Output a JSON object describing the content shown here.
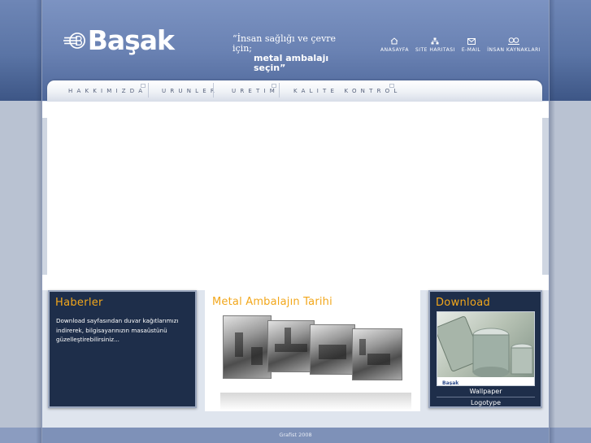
{
  "brand": {
    "name": "Başak"
  },
  "slogan": {
    "line1": "“İnsan sağlığı ve çevre için;",
    "line2": "metal ambalajı seçin”"
  },
  "toplinks": [
    {
      "label": "ANASAYFA",
      "icon": "home-icon"
    },
    {
      "label": "SITE HARITASI",
      "icon": "sitemap-icon"
    },
    {
      "label": "E-MAIL",
      "icon": "mail-icon"
    },
    {
      "label": "İNSAN KAYNAKLARI",
      "icon": "people-icon"
    }
  ],
  "nav": [
    {
      "label": "HAKKIMIZDA"
    },
    {
      "label": "URUNLER"
    },
    {
      "label": "URETIM"
    },
    {
      "label": "KALITE KONTROL"
    }
  ],
  "news": {
    "title": "Haberler",
    "text": "Download sayfasından duvar kağıtlarımızı indirerek, bilgisayarınızın masaüstünü güzelleştirebilirsiniz..."
  },
  "history": {
    "title": "Metal Ambalajın Tarihi"
  },
  "download": {
    "title": "Download",
    "wallpaper_label": "Wallpaper",
    "logotype_label": "Logotype"
  },
  "footer": {
    "text": "Grafist 2008"
  },
  "colors": {
    "accent": "#f2a71b",
    "box_dark": "#1e2e4a",
    "header_blue": "#6a82b3"
  }
}
